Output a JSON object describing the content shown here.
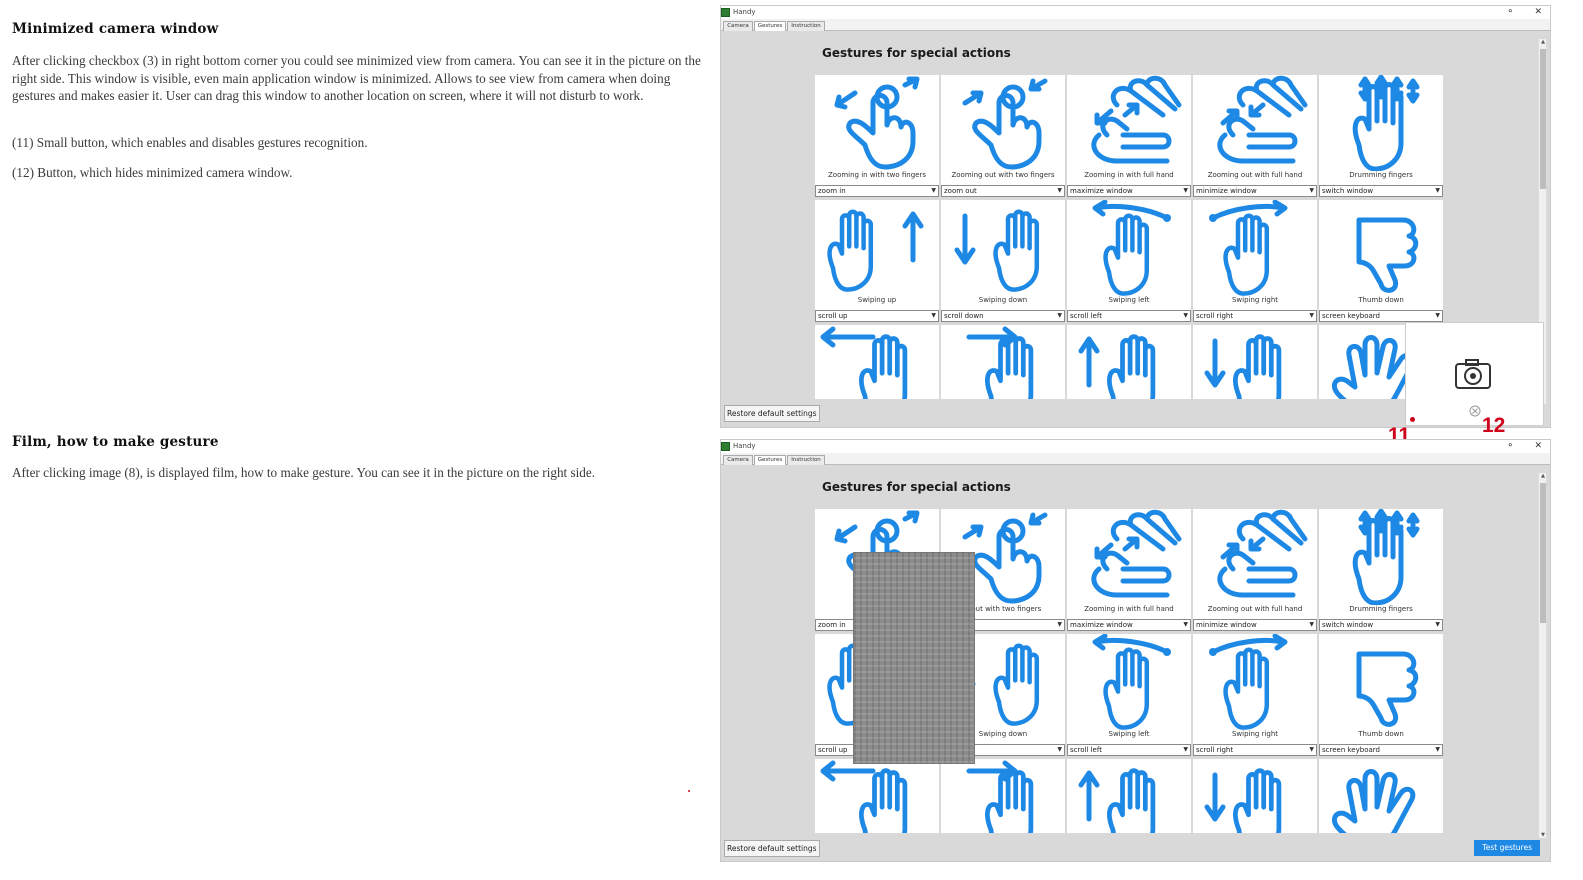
{
  "doc": {
    "section1": {
      "heading": "Minimized camera window",
      "paragraph": "After clicking checkbox (3) in right bottom corner you could see minimized view from camera. You can see it in the picture on the right side. This window is visible, even main application window is minimized. Allows to see view from camera when doing gestures and makes easier it. User can drag this window to another location on screen, where it will not disturb to work.",
      "item11": "(11) Small button, which enables and disables gestures recognition.",
      "item12": "(12) Button, which hides minimized camera window."
    },
    "section2": {
      "heading": "Film, how to make gesture",
      "paragraph": "After clicking image (8), is displayed film, how to make gesture. You can see it in the picture on the right side."
    }
  },
  "app": {
    "title": "Handy",
    "tabs": [
      "Camera",
      "Gestures",
      "Instruction"
    ],
    "section_title": "Gestures for special actions",
    "restore_label": "Restore default settings",
    "test_label": "Test gestures",
    "accent": "#1e88e5",
    "gestures": [
      {
        "label": "Zooming in with two fingers",
        "action": "zoom in",
        "icon": "zoom-in-two-fingers-icon"
      },
      {
        "label": "Zooming out with two fingers",
        "action": "zoom out",
        "icon": "zoom-out-two-fingers-icon"
      },
      {
        "label": "Zooming in with full hand",
        "action": "maximize window",
        "icon": "zoom-in-full-hand-icon"
      },
      {
        "label": "Zooming out with full hand",
        "action": "minimize window",
        "icon": "zoom-out-full-hand-icon"
      },
      {
        "label": "Drumming fingers",
        "action": "switch window",
        "icon": "drumming-fingers-icon"
      },
      {
        "label": "Swiping up",
        "action": "scroll up",
        "icon": "swipe-up-icon"
      },
      {
        "label": "Swiping down",
        "action": "scroll down",
        "icon": "swipe-down-icon"
      },
      {
        "label": "Swiping left",
        "action": "scroll left",
        "icon": "swipe-left-icon"
      },
      {
        "label": "Swiping right",
        "action": "scroll right",
        "icon": "swipe-right-icon"
      },
      {
        "label": "Thumb down",
        "action": "screen keyboard",
        "icon": "thumb-down-icon"
      }
    ],
    "row3_icons": [
      "point-left-icon",
      "point-right-icon",
      "point-up-icon",
      "point-down-icon",
      "wave-hand-icon"
    ],
    "window2_labels": [
      "Zoomin",
      "g out with two fingers",
      "Zooming in with full hand",
      "Zooming out with full hand",
      "Drumming fingers",
      "",
      "Swiping down",
      "Swiping left",
      "Swiping right",
      "Thumb down"
    ],
    "window2_actions": [
      "zoom in",
      "t",
      "maximize window",
      "minimize window",
      "switch window",
      "scroll up",
      "wn",
      "scroll left",
      "scroll right",
      "screen keyboard"
    ]
  },
  "annotations": {
    "n11": "11",
    "n12": "12"
  }
}
